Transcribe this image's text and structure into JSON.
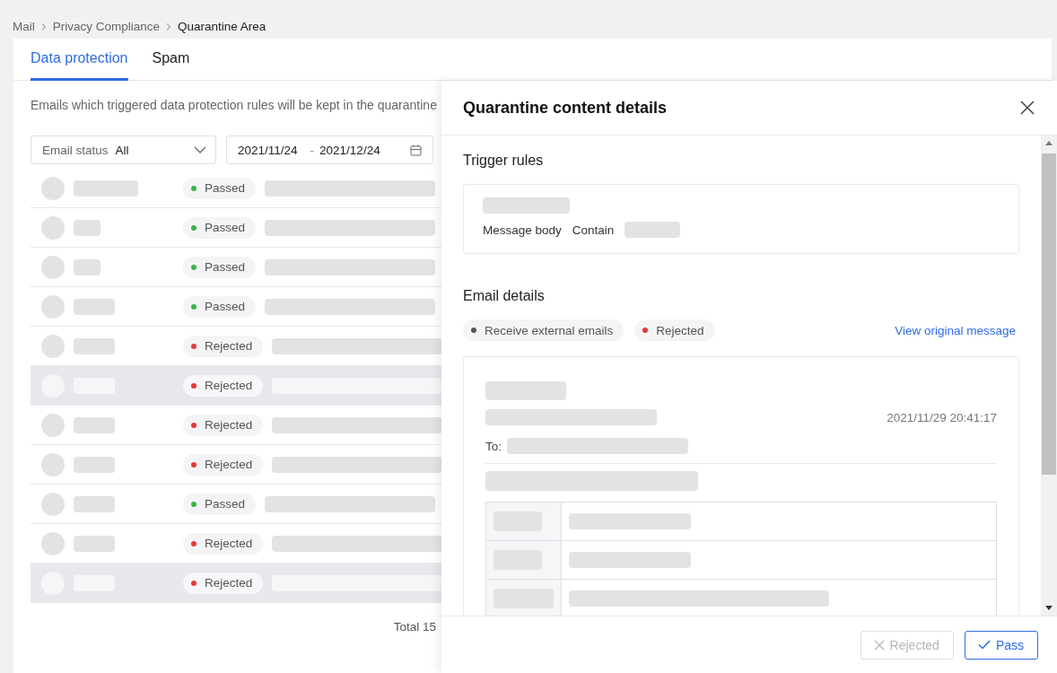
{
  "breadcrumb": [
    {
      "label": "Mail",
      "current": false
    },
    {
      "label": "Privacy Compliance",
      "current": false
    },
    {
      "label": "Quarantine Area",
      "current": true
    }
  ],
  "tabs": [
    {
      "label": "Data protection",
      "selected": true
    },
    {
      "label": "Spam",
      "selected": false
    }
  ],
  "description": "Emails which triggered data protection rules will be kept in the quarantine",
  "filters": {
    "status_label": "Email status",
    "status_value": "All",
    "date_start": "2021/11/24",
    "date_separator": "-",
    "date_end": "2021/12/24"
  },
  "rows": [
    {
      "status": "Passed",
      "color": "#3bb346",
      "selected": false
    },
    {
      "status": "Passed",
      "color": "#3bb346",
      "selected": false
    },
    {
      "status": "Passed",
      "color": "#3bb346",
      "selected": false
    },
    {
      "status": "Passed",
      "color": "#3bb346",
      "selected": false
    },
    {
      "status": "Rejected",
      "color": "#e5383b",
      "selected": false
    },
    {
      "status": "Rejected",
      "color": "#e5383b",
      "selected": true
    },
    {
      "status": "Rejected",
      "color": "#e5383b",
      "selected": false
    },
    {
      "status": "Rejected",
      "color": "#e5383b",
      "selected": false
    },
    {
      "status": "Passed",
      "color": "#3bb346",
      "selected": false
    },
    {
      "status": "Rejected",
      "color": "#e5383b",
      "selected": false
    },
    {
      "status": "Rejected",
      "color": "#e5383b",
      "selected": true
    }
  ],
  "total": "Total 15",
  "drawer": {
    "title": "Quarantine content details",
    "trigger_title": "Trigger rules",
    "rule": {
      "field": "Message body",
      "operator": "Contain"
    },
    "email_title": "Email details",
    "chips": [
      {
        "label": "Receive external emails",
        "color": "#555555"
      },
      {
        "label": "Rejected",
        "color": "#e5383b"
      }
    ],
    "view_link": "View original message",
    "email": {
      "time": "2021/11/29 20:41:17",
      "to_label": "To:"
    },
    "buttons": [
      {
        "label": "Rejected",
        "kind": "reject",
        "disabled": true
      },
      {
        "label": "Pass",
        "kind": "pass",
        "disabled": false
      }
    ]
  }
}
